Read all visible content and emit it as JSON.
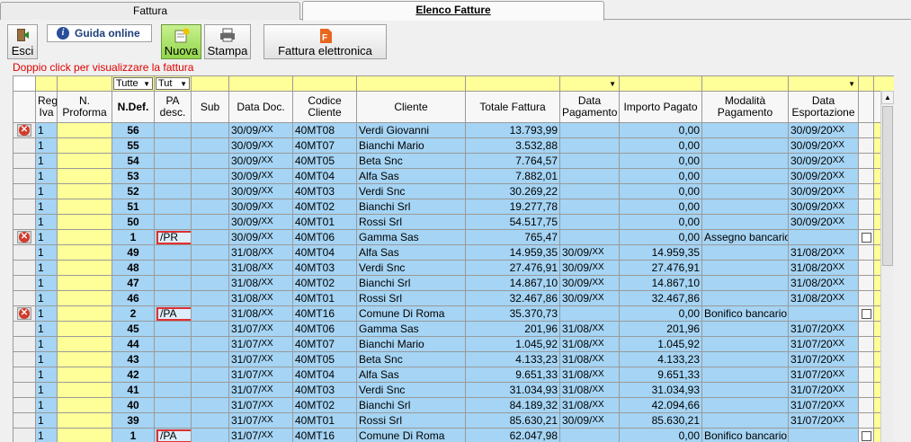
{
  "tabs": [
    {
      "label": "Fattura"
    },
    {
      "label": "Elenco Fatture"
    }
  ],
  "toolbar": {
    "esci": "Esci",
    "guida": "Guida online",
    "nuova": "Nuova",
    "stampa": "Stampa",
    "fattura_elettronica": "Fattura elettronica"
  },
  "hint": "Doppio click per visualizzare la fattura",
  "filters": {
    "ndef": "Tutte",
    "pa": "Tut"
  },
  "columns": {
    "reg_iva": "Reg Iva",
    "n_proforma": "N. Proforma",
    "n_def": "N.Def.",
    "pa_desc": "PA desc.",
    "sub": "Sub",
    "data_doc": "Data Doc.",
    "codice_cliente": "Codice Cliente",
    "cliente": "Cliente",
    "totale": "Totale Fattura",
    "data_pag": "Data Pagamento",
    "importo": "Importo Pagato",
    "modalita": "Modalità Pagamento",
    "data_esp": "Data Esportazione"
  },
  "rows": [
    {
      "del": true,
      "reg": "1",
      "ndef": "56",
      "pa": "",
      "dd": "30/09/",
      "ddy": "XX",
      "cod": "40MT08",
      "cli": "Verdi Giovanni",
      "tot": "13.793,99",
      "dp": "",
      "dpy": "",
      "imp": "0,00",
      "mod": "",
      "de": "30/09/20",
      "dey": "XX",
      "chk": false
    },
    {
      "del": false,
      "reg": "1",
      "ndef": "55",
      "pa": "",
      "dd": "30/09/",
      "ddy": "XX",
      "cod": "40MT07",
      "cli": "Bianchi Mario",
      "tot": "3.532,88",
      "dp": "",
      "dpy": "",
      "imp": "0,00",
      "mod": "",
      "de": "30/09/20",
      "dey": "XX",
      "chk": false
    },
    {
      "del": false,
      "reg": "1",
      "ndef": "54",
      "pa": "",
      "dd": "30/09/",
      "ddy": "XX",
      "cod": "40MT05",
      "cli": "Beta Snc",
      "tot": "7.764,57",
      "dp": "",
      "dpy": "",
      "imp": "0,00",
      "mod": "",
      "de": "30/09/20",
      "dey": "XX",
      "chk": false
    },
    {
      "del": false,
      "reg": "1",
      "ndef": "53",
      "pa": "",
      "dd": "30/09/",
      "ddy": "XX",
      "cod": "40MT04",
      "cli": "Alfa Sas",
      "tot": "7.882,01",
      "dp": "",
      "dpy": "",
      "imp": "0,00",
      "mod": "",
      "de": "30/09/20",
      "dey": "XX",
      "chk": false
    },
    {
      "del": false,
      "reg": "1",
      "ndef": "52",
      "pa": "",
      "dd": "30/09/",
      "ddy": "XX",
      "cod": "40MT03",
      "cli": "Verdi Snc",
      "tot": "30.269,22",
      "dp": "",
      "dpy": "",
      "imp": "0,00",
      "mod": "",
      "de": "30/09/20",
      "dey": "XX",
      "chk": false
    },
    {
      "del": false,
      "reg": "1",
      "ndef": "51",
      "pa": "",
      "dd": "30/09/",
      "ddy": "XX",
      "cod": "40MT02",
      "cli": "Bianchi Srl",
      "tot": "19.277,78",
      "dp": "",
      "dpy": "",
      "imp": "0,00",
      "mod": "",
      "de": "30/09/20",
      "dey": "XX",
      "chk": false
    },
    {
      "del": false,
      "reg": "1",
      "ndef": "50",
      "pa": "",
      "dd": "30/09/",
      "ddy": "XX",
      "cod": "40MT01",
      "cli": "Rossi Srl",
      "tot": "54.517,75",
      "dp": "",
      "dpy": "",
      "imp": "0,00",
      "mod": "",
      "de": "30/09/20",
      "dey": "XX",
      "chk": false
    },
    {
      "del": true,
      "reg": "1",
      "ndef": "1",
      "pa": "/PR",
      "dd": "30/09/",
      "ddy": "XX",
      "cod": "40MT06",
      "cli": "Gamma Sas",
      "tot": "765,47",
      "dp": "",
      "dpy": "",
      "imp": "0,00",
      "mod": "Assegno bancario",
      "de": "",
      "dey": "",
      "chk": true
    },
    {
      "del": false,
      "reg": "1",
      "ndef": "49",
      "pa": "",
      "dd": "31/08/",
      "ddy": "XX",
      "cod": "40MT04",
      "cli": "Alfa Sas",
      "tot": "14.959,35",
      "dp": "30/09/",
      "dpy": "XX",
      "imp": "14.959,35",
      "mod": "",
      "de": "31/08/20",
      "dey": "XX",
      "chk": false
    },
    {
      "del": false,
      "reg": "1",
      "ndef": "48",
      "pa": "",
      "dd": "31/08/",
      "ddy": "XX",
      "cod": "40MT03",
      "cli": "Verdi Snc",
      "tot": "27.476,91",
      "dp": "30/09/",
      "dpy": "XX",
      "imp": "27.476,91",
      "mod": "",
      "de": "31/08/20",
      "dey": "XX",
      "chk": false
    },
    {
      "del": false,
      "reg": "1",
      "ndef": "47",
      "pa": "",
      "dd": "31/08/",
      "ddy": "XX",
      "cod": "40MT02",
      "cli": "Bianchi Srl",
      "tot": "14.867,10",
      "dp": "30/09/",
      "dpy": "XX",
      "imp": "14.867,10",
      "mod": "",
      "de": "31/08/20",
      "dey": "XX",
      "chk": false
    },
    {
      "del": false,
      "reg": "1",
      "ndef": "46",
      "pa": "",
      "dd": "31/08/",
      "ddy": "XX",
      "cod": "40MT01",
      "cli": "Rossi Srl",
      "tot": "32.467,86",
      "dp": "30/09/",
      "dpy": "XX",
      "imp": "32.467,86",
      "mod": "",
      "de": "31/08/20",
      "dey": "XX",
      "chk": false
    },
    {
      "del": true,
      "reg": "1",
      "ndef": "2",
      "pa": "/PA",
      "dd": "31/08/",
      "ddy": "XX",
      "cod": "40MT16",
      "cli": "Comune Di Roma",
      "tot": "35.370,73",
      "dp": "",
      "dpy": "",
      "imp": "0,00",
      "mod": "Bonifico bancario",
      "de": "",
      "dey": "",
      "chk": true
    },
    {
      "del": false,
      "reg": "1",
      "ndef": "45",
      "pa": "",
      "dd": "31/07/",
      "ddy": "XX",
      "cod": "40MT06",
      "cli": "Gamma Sas",
      "tot": "201,96",
      "dp": "31/08/",
      "dpy": "XX",
      "imp": "201,96",
      "mod": "",
      "de": "31/07/20",
      "dey": "XX",
      "chk": false
    },
    {
      "del": false,
      "reg": "1",
      "ndef": "44",
      "pa": "",
      "dd": "31/07/",
      "ddy": "XX",
      "cod": "40MT07",
      "cli": "Bianchi Mario",
      "tot": "1.045,92",
      "dp": "31/08/",
      "dpy": "XX",
      "imp": "1.045,92",
      "mod": "",
      "de": "31/07/20",
      "dey": "XX",
      "chk": false
    },
    {
      "del": false,
      "reg": "1",
      "ndef": "43",
      "pa": "",
      "dd": "31/07/",
      "ddy": "XX",
      "cod": "40MT05",
      "cli": "Beta Snc",
      "tot": "4.133,23",
      "dp": "31/08/",
      "dpy": "XX",
      "imp": "4.133,23",
      "mod": "",
      "de": "31/07/20",
      "dey": "XX",
      "chk": false
    },
    {
      "del": false,
      "reg": "1",
      "ndef": "42",
      "pa": "",
      "dd": "31/07/",
      "ddy": "XX",
      "cod": "40MT04",
      "cli": "Alfa Sas",
      "tot": "9.651,33",
      "dp": "31/08/",
      "dpy": "XX",
      "imp": "9.651,33",
      "mod": "",
      "de": "31/07/20",
      "dey": "XX",
      "chk": false
    },
    {
      "del": false,
      "reg": "1",
      "ndef": "41",
      "pa": "",
      "dd": "31/07/",
      "ddy": "XX",
      "cod": "40MT03",
      "cli": "Verdi Snc",
      "tot": "31.034,93",
      "dp": "31/08/",
      "dpy": "XX",
      "imp": "31.034,93",
      "mod": "",
      "de": "31/07/20",
      "dey": "XX",
      "chk": false
    },
    {
      "del": false,
      "reg": "1",
      "ndef": "40",
      "pa": "",
      "dd": "31/07/",
      "ddy": "XX",
      "cod": "40MT02",
      "cli": "Bianchi Srl",
      "tot": "84.189,32",
      "dp": "31/08/",
      "dpy": "XX",
      "imp": "42.094,66",
      "mod": "",
      "de": "31/07/20",
      "dey": "XX",
      "chk": false
    },
    {
      "del": false,
      "reg": "1",
      "ndef": "39",
      "pa": "",
      "dd": "31/07/",
      "ddy": "XX",
      "cod": "40MT01",
      "cli": "Rossi Srl",
      "tot": "85.630,21",
      "dp": "30/09/",
      "dpy": "XX",
      "imp": "85.630,21",
      "mod": "",
      "de": "31/07/20",
      "dey": "XX",
      "chk": false
    },
    {
      "del": false,
      "reg": "1",
      "ndef": "1",
      "pa": "/PA",
      "dd": "31/07/",
      "ddy": "XX",
      "cod": "40MT16",
      "cli": "Comune Di Roma",
      "tot": "62.047,98",
      "dp": "",
      "dpy": "",
      "imp": "0,00",
      "mod": "Bonifico bancario",
      "de": "",
      "dey": "",
      "chk": true
    }
  ]
}
